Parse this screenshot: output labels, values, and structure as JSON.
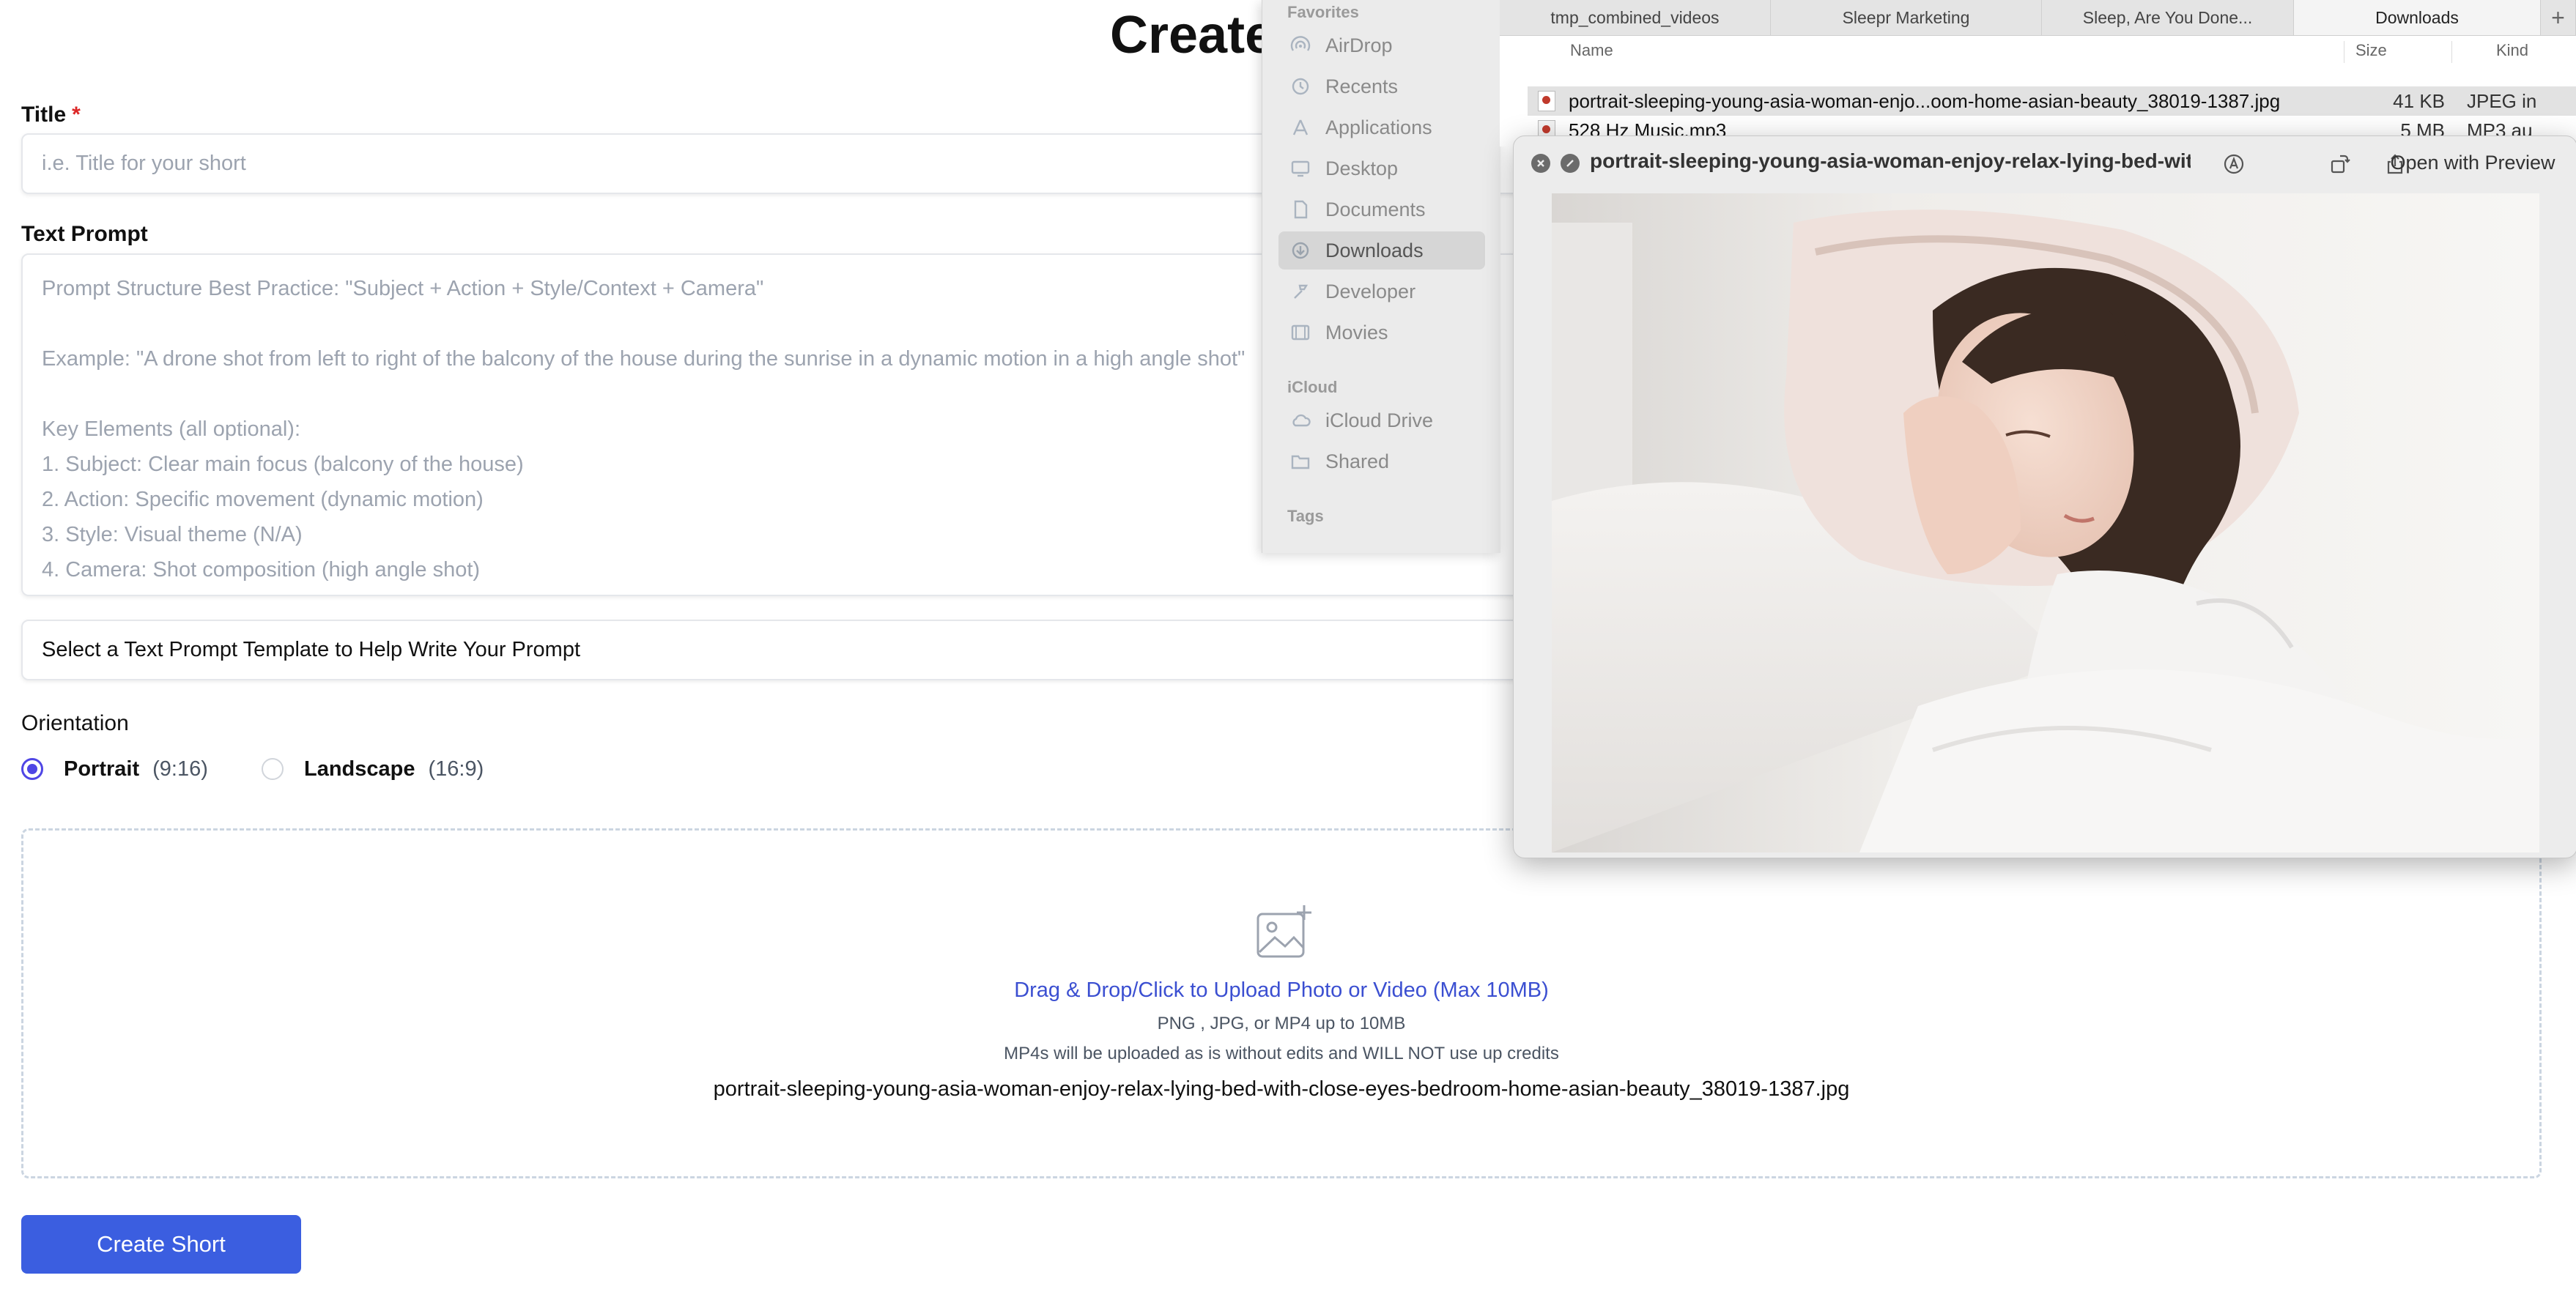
{
  "page": {
    "title": "Create"
  },
  "form": {
    "title_label": "Title",
    "required_mark": "*",
    "title_placeholder": "i.e. Title for your short",
    "prompt_label": "Text Prompt",
    "prompt_lines": [
      "Prompt Structure Best Practice: \"Subject + Action + Style/Context + Camera\"",
      "",
      "Example: \"A drone shot from left to right of the balcony of the house during the sunrise in a dynamic motion in a high angle shot\"",
      "",
      "Key Elements (all optional):",
      "1. Subject: Clear main focus (balcony of the house)",
      "2. Action: Specific movement (dynamic motion)",
      "3. Style: Visual theme (N/A)",
      "4. Camera: Shot composition (high angle shot)"
    ],
    "template_select": "Select a Text Prompt Template to Help Write Your Prompt",
    "orientation_label": "Orientation",
    "orientation_options": [
      {
        "label": "Portrait",
        "ratio": "(9:16)",
        "checked": true
      },
      {
        "label": "Landscape",
        "ratio": "(16:9)",
        "checked": false
      }
    ],
    "upload": {
      "cta": "Drag & Drop/Click to Upload Photo or Video (Max 10MB)",
      "formats": "PNG , JPG, or MP4 up to 10MB",
      "note": "MP4s will be uploaded as is without edits and WILL NOT use up credits",
      "filename": "portrait-sleeping-young-asia-woman-enjoy-relax-lying-bed-with-close-eyes-bedroom-home-asian-beauty_38019-1387.jpg"
    },
    "submit_label": "Create Short"
  },
  "finder": {
    "sidebar": {
      "favorites_header": "Favorites",
      "favorites": [
        {
          "label": "AirDrop",
          "icon": "airdrop-icon"
        },
        {
          "label": "Recents",
          "icon": "clock-icon"
        },
        {
          "label": "Applications",
          "icon": "applications-icon"
        },
        {
          "label": "Desktop",
          "icon": "desktop-icon"
        },
        {
          "label": "Documents",
          "icon": "document-icon"
        },
        {
          "label": "Downloads",
          "icon": "download-icon",
          "active": true
        },
        {
          "label": "Developer",
          "icon": "hammer-icon"
        },
        {
          "label": "Movies",
          "icon": "film-icon"
        }
      ],
      "icloud_header": "iCloud",
      "icloud": [
        {
          "label": "iCloud Drive",
          "icon": "cloud-icon"
        },
        {
          "label": "Shared",
          "icon": "shared-folder-icon"
        }
      ],
      "tags_header": "Tags"
    },
    "tabs": [
      "tmp_combined_videos",
      "Sleepr Marketing",
      "Sleep, Are You Done...",
      "Downloads"
    ],
    "active_tab": 3,
    "columns": {
      "name": "Name",
      "size": "Size",
      "kind": "Kind"
    },
    "files": [
      {
        "name": "portrait-sleeping-young-asia-woman-enjo...oom-home-asian-beauty_38019-1387.jpg",
        "size": "41 KB",
        "kind": "JPEG in"
      },
      {
        "name": "528 Hz Music.mp3",
        "size": "5 MB",
        "kind": "MP3 au"
      }
    ]
  },
  "quicklook": {
    "title": "portrait-sleeping-young-asia-woman-enjoy-relax-lying-bed-wit...",
    "open_with": "Open with Preview"
  },
  "colors": {
    "accent": "#4f46e5",
    "button": "#3b5ee0",
    "link": "#3b4fd1",
    "required": "#dc2626"
  }
}
